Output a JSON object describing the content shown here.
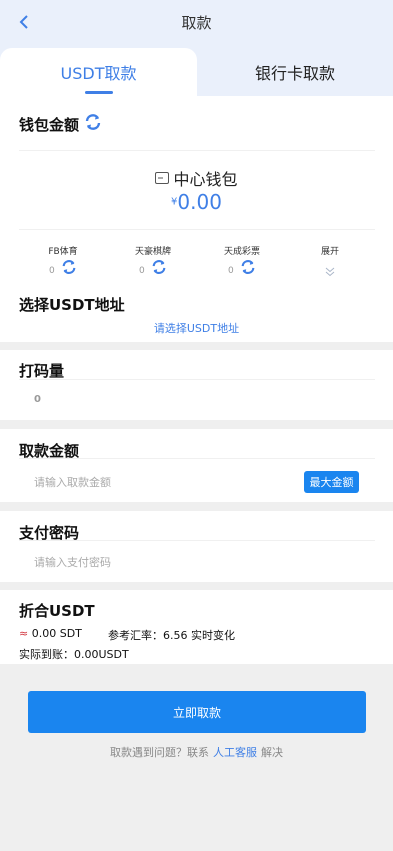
{
  "header": {
    "title": "取款"
  },
  "tabs": [
    {
      "label": "USDT取款",
      "active": true
    },
    {
      "label": "银行卡取款",
      "active": false
    }
  ],
  "wallet": {
    "title": "钱包金额",
    "center_label": "中心钱包",
    "currency_symbol": "¥",
    "balance": "0.00",
    "venues": [
      {
        "name": "FB体育",
        "value": "0"
      },
      {
        "name": "天豪棋牌",
        "value": "0"
      },
      {
        "name": "天成彩票",
        "value": "0"
      }
    ],
    "expand_label": "展开"
  },
  "address": {
    "title": "选择USDT地址",
    "link": "请选择USDT地址"
  },
  "turnover": {
    "title": "打码量",
    "value": "0"
  },
  "amount": {
    "title": "取款金额",
    "placeholder": "请输入取款金额",
    "max_label": "最大金额"
  },
  "password": {
    "title": "支付密码",
    "placeholder": "请输入支付密码"
  },
  "usdt": {
    "title": "折合USDT",
    "approx_symbol": "≈",
    "amount": "0.00 SDT",
    "rate_text": "参考汇率：6.56 实时变化",
    "arrival": "实际到账：0.00USDT"
  },
  "submit_label": "立即取款",
  "help": {
    "prefix": "取款遇到问题？联系",
    "service": "人工客服",
    "suffix": "解决"
  },
  "colors": {
    "accent": "#3f7fe6",
    "button": "#1a85ef",
    "approx": "#d0303a"
  }
}
